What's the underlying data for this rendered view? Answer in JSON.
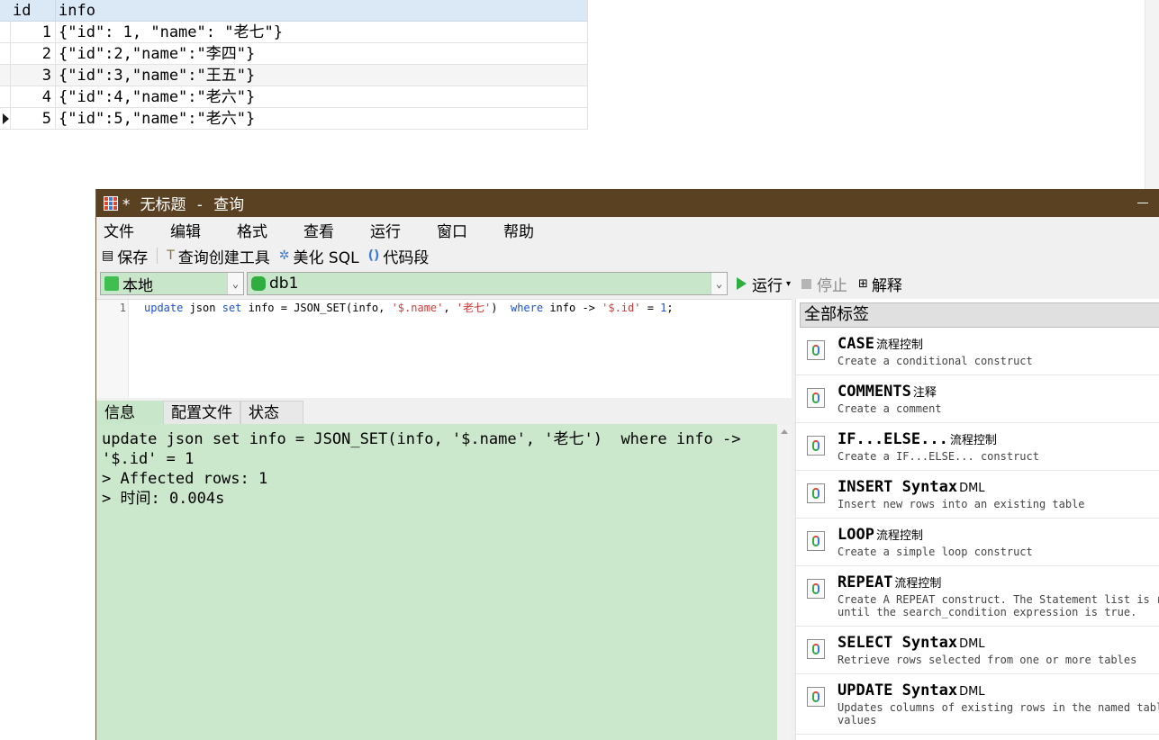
{
  "grid": {
    "columns": [
      "id",
      "info"
    ],
    "rows": [
      {
        "id": "1",
        "info": "{\"id\": 1, \"name\": \"老七\"}"
      },
      {
        "id": "2",
        "info": "{\"id\":2,\"name\":\"李四\"}"
      },
      {
        "id": "3",
        "info": "{\"id\":3,\"name\":\"王五\"}"
      },
      {
        "id": "4",
        "info": "{\"id\":4,\"name\":\"老六\"}"
      },
      {
        "id": "5",
        "info": "{\"id\":5,\"name\":\"老六\"}"
      }
    ]
  },
  "window": {
    "title": "* 无标题 - 查询",
    "icon": "query-grid-icon"
  },
  "menu": [
    "文件",
    "编辑",
    "格式",
    "查看",
    "运行",
    "窗口",
    "帮助"
  ],
  "toolbar": {
    "save": "保存",
    "query_builder": "查询创建工具",
    "beautify": "美化 SQL",
    "snippets": "代码段"
  },
  "connection": {
    "conn_value": "本地",
    "db_value": "db1",
    "run": "运行",
    "stop": "停止",
    "explain": "解释"
  },
  "editor": {
    "line_number": "1",
    "code_parts": {
      "kw_update": "update",
      "t1": " json ",
      "kw_set": "set",
      "t2": " info = JSON_SET(info, ",
      "s1": "'$.name'",
      "t3": ", ",
      "s2": "'老七'",
      "t4": ")  ",
      "kw_where": "where",
      "t5": " info -> ",
      "s3": "'$.id'",
      "t6": " = ",
      "n1": "1",
      "t7": ";"
    }
  },
  "result_tabs": [
    "信息",
    "配置文件",
    "状态"
  ],
  "output": {
    "lines": [
      "update json set info = JSON_SET(info, '$.name', '老七')  where info ->",
      "'$.id' = 1",
      "> Affected rows: 1",
      "> 时间: 0.004s"
    ]
  },
  "snippets": {
    "header": "全部标签",
    "items": [
      {
        "title": "CASE",
        "tag": "流程控制",
        "desc": "Create a conditional construct"
      },
      {
        "title": "COMMENTS",
        "tag": "注释",
        "desc": "Create a comment"
      },
      {
        "title": "IF...ELSE...",
        "tag": "流程控制",
        "desc": "Create a IF...ELSE... construct"
      },
      {
        "title": "INSERT Syntax",
        "tag": "DML",
        "desc": "Insert new rows into an existing table"
      },
      {
        "title": "LOOP",
        "tag": "流程控制",
        "desc": "Create a simple loop construct"
      },
      {
        "title": "REPEAT",
        "tag": "流程控制",
        "desc": "Create A REPEAT construct. The Statement list is rep\nuntil the search_condition expression is true."
      },
      {
        "title": "SELECT Syntax",
        "tag": "DML",
        "desc": "Retrieve rows selected from one or more tables"
      },
      {
        "title": "UPDATE Syntax",
        "tag": "DML",
        "desc": "Updates columns of existing rows in the named table\nvalues"
      }
    ]
  }
}
